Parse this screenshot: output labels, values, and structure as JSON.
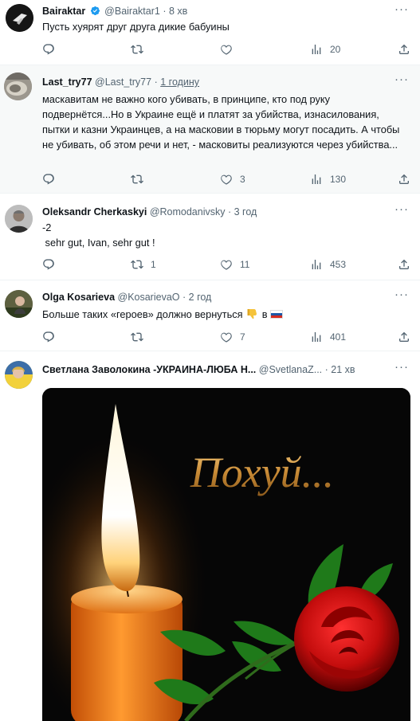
{
  "tweets": [
    {
      "name": "Bairaktar",
      "handle": "@Bairaktar1",
      "time": "8 хв",
      "text": "Пусть хуярят друг друга дикие бабуины",
      "replies": "",
      "retweets": "",
      "likes": "",
      "views": "20"
    },
    {
      "name": "Last_try77",
      "handle": "@Last_try77",
      "time": "1 годину",
      "text": "маскавитам не важно кого убивать, в принципе, кто под руку подвернётся...Но в Украине ещё и платят за убийства, изнасилования, пытки и казни Украинцев, а на масковии в тюрьму могут посадить. А чтобы не убивать, об этом речи и нет, - масковиты реализуются через убийства...",
      "replies": "",
      "retweets": "",
      "likes": "3",
      "views": "130"
    },
    {
      "name": "Oleksandr Cherkaskyi",
      "handle": "@Romodanivsky",
      "time": "3 год",
      "line1": "-2",
      "line2": " sehr gut, Ivan, sehr gut !",
      "replies": "",
      "retweets": "1",
      "likes": "11",
      "views": "453"
    },
    {
      "name": "Olga Kosarieva",
      "handle": "@KosarievaO",
      "time": "2 год",
      "text_before": "Больше таких «героев» должно вернуться",
      "text_after": "в",
      "replies": "",
      "retweets": "",
      "likes": "7",
      "views": "401"
    },
    {
      "name": "Светлана Заволокина -УКРАИНА-ЛЮБА Н...",
      "handle": "@SvetlanaZ...",
      "time": "21 хв",
      "image_caption": "Похуй..."
    }
  ],
  "separator": "·",
  "icons": {
    "reply": "reply-icon",
    "retweet": "retweet-icon",
    "like": "heart-icon",
    "views": "views-icon",
    "share": "share-icon",
    "more": "more-icon",
    "verified": "verified-badge-icon"
  },
  "colors": {
    "verified": "#1d9bf0",
    "secondary": "#536471",
    "divider": "#eff3f4",
    "highlight_bg": "#f7f9f9"
  }
}
